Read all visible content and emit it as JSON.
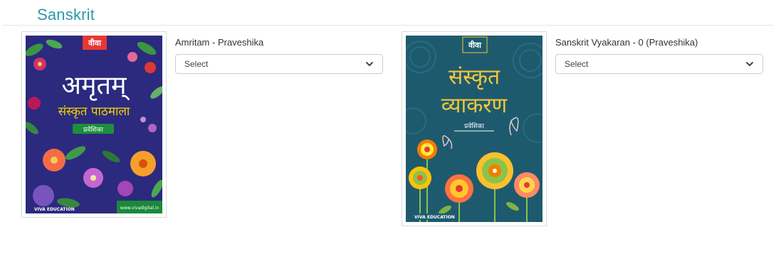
{
  "section": {
    "title": "Sanskrit"
  },
  "books": [
    {
      "title": "Amritam - Praveshika",
      "select_value": "Select",
      "cover": {
        "badge": "वीवा",
        "main_title": "अमृतम्",
        "subtitle": "संस्कृत पाठमाला",
        "level": "प्रवेशिका",
        "publisher": "VIVA EDUCATION",
        "website": "www.vivadigital.in",
        "bg_color": "#2b2a7e",
        "title_color": "#ffffff",
        "subtitle_color": "#f5d200",
        "level_bg": "#1e8e3e"
      }
    },
    {
      "title": "Sanskrit Vyakaran - 0 (Praveshika)",
      "select_value": "Select",
      "cover": {
        "badge": "वीवा",
        "main_title_line1": "संस्कृत",
        "main_title_line2": "व्याकरण",
        "level": "प्रवेशिका",
        "publisher": "VIVA EDUCATION",
        "bg_color": "#1e5a6e",
        "title_color": "#f2c73a"
      }
    }
  ]
}
